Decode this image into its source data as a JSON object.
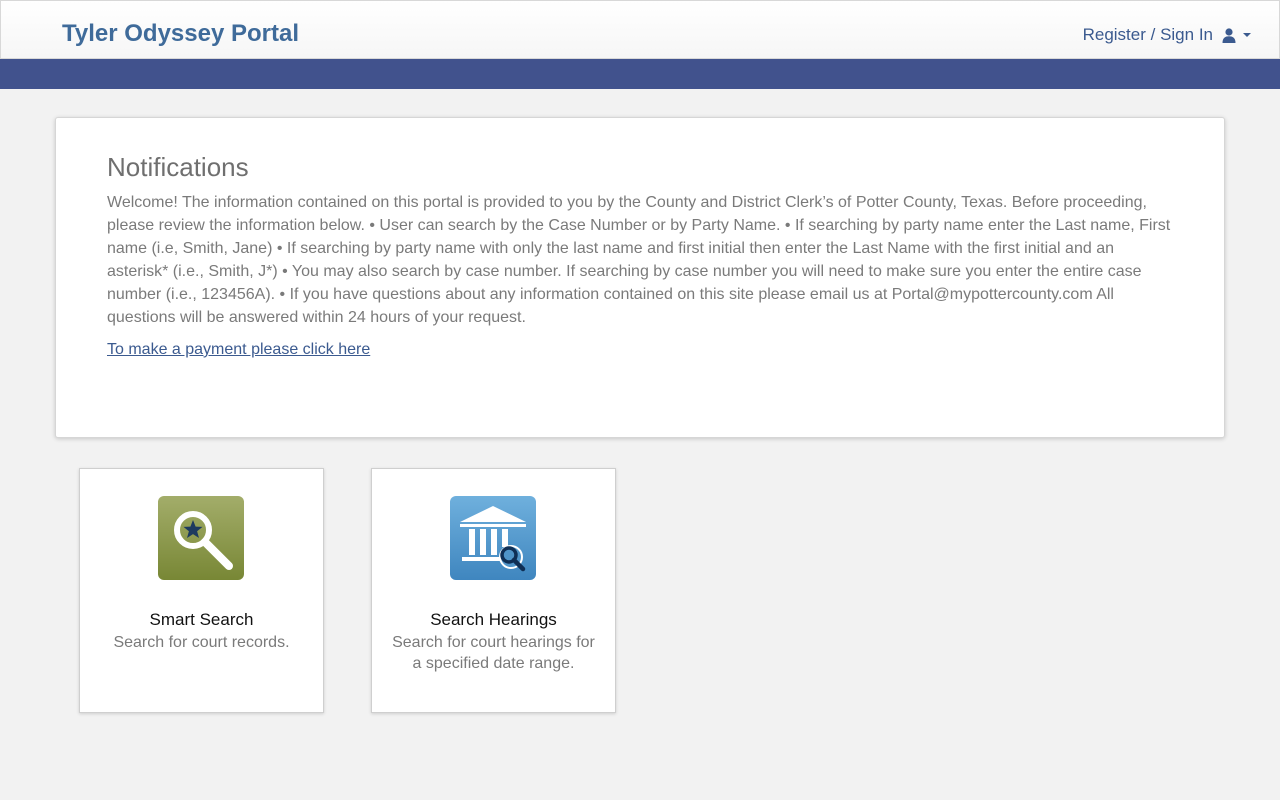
{
  "header": {
    "brand": "Tyler Odyssey Portal",
    "signin_label": "Register / Sign In",
    "user_icon": "user-icon",
    "caret_icon": "caret-down-icon",
    "brand_color": "#3f6b9a",
    "banner_color": "#41528d"
  },
  "notifications": {
    "title": "Notifications",
    "body": "Welcome! The information contained on this portal is provided to you by the County and District Clerk’s of Potter County, Texas. Before proceeding, please review the information below. • User can search by the Case Number or by Party Name. • If searching by party name enter the Last name, First name (i.e, Smith, Jane) • If searching by party name with only the last name and first initial then enter the Last Name with the first initial and an asterisk* (i.e., Smith, J*) • You may also search by case number. If searching by case number you will need to make sure you enter the entire case number (i.e., 123456A). • If you have questions about any information contained on this site please email us at Portal@mypottercounty.com All questions will be answered within 24 hours of your request.",
    "payment_link": "To make a payment please click here"
  },
  "tiles": [
    {
      "title": "Smart Search",
      "description": "Search for court records.",
      "icon": "smart-search-icon",
      "icon_color": "#7f8f3f"
    },
    {
      "title": "Search Hearings",
      "description": "Search for court hearings for a specified date range.",
      "icon": "courthouse-search-icon",
      "icon_color": "#4f94c8"
    }
  ]
}
